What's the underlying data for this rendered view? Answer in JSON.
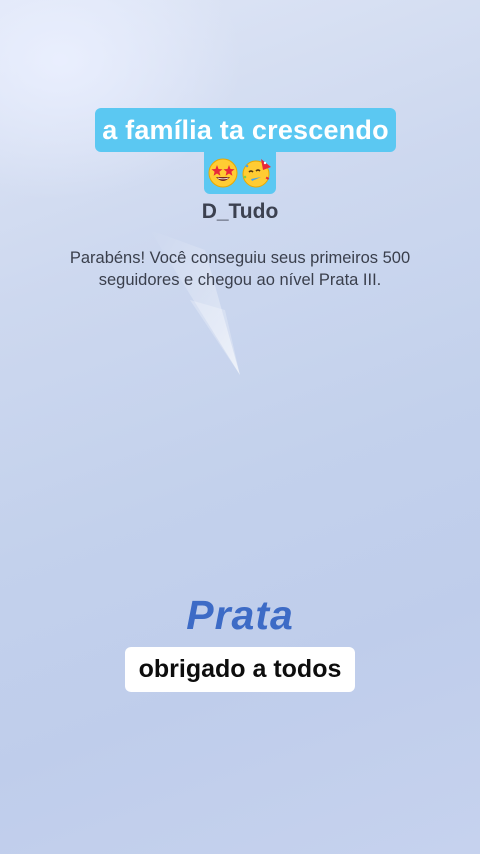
{
  "caption_top": {
    "text": "a família ta crescendo",
    "emojis": [
      "star-struck-emoji",
      "partying-face-emoji"
    ]
  },
  "username": "D_Tudo",
  "message": "Parabéns! Você conseguiu seus primeiros 500 seguidores e chegou ao nível Prata III.",
  "level_badge": "Prata",
  "caption_bottom": "obrigado a todos",
  "colors": {
    "caption_bg": "#5bc8f2",
    "level_text": "#3d6bc6",
    "background": "#c6d3ee"
  }
}
